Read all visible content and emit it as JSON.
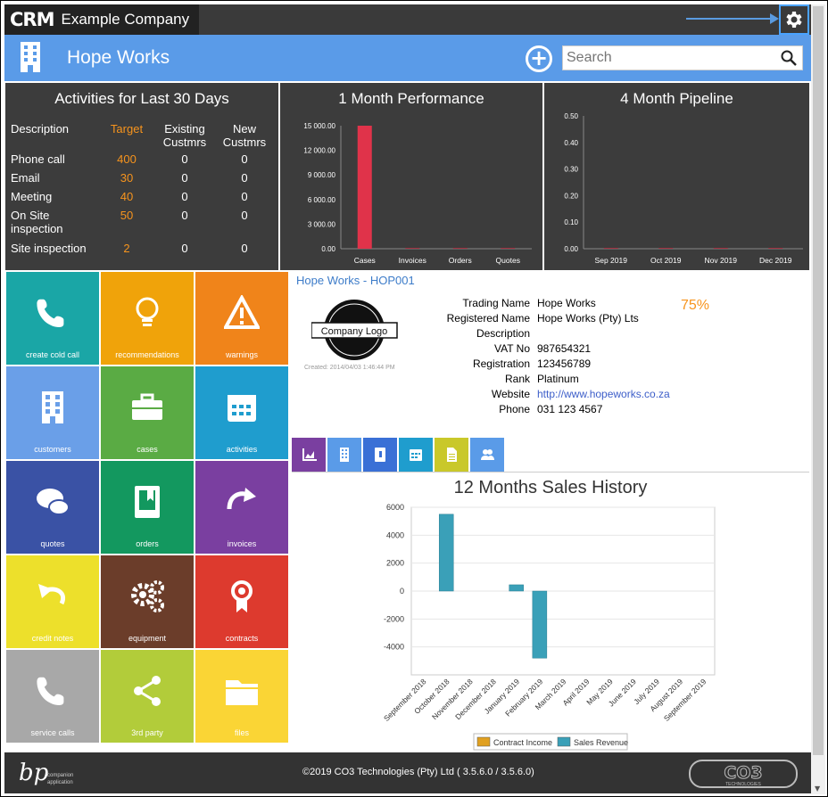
{
  "app": {
    "logo_text": "CRM",
    "company": "Example Company"
  },
  "header": {
    "title": "Hope Works",
    "search_placeholder": "Search"
  },
  "activities": {
    "title": "Activities for Last 30 Days",
    "headers": {
      "description": "Description",
      "target": "Target",
      "existing": "Existing Custmrs",
      "new": "New Custmrs"
    },
    "rows": [
      {
        "desc": "Phone call",
        "target": "400",
        "existing": "0",
        "new": "0"
      },
      {
        "desc": "Email",
        "target": "30",
        "existing": "0",
        "new": "0"
      },
      {
        "desc": "Meeting",
        "target": "40",
        "existing": "0",
        "new": "0"
      },
      {
        "desc": "On Site inspection",
        "target": "50",
        "existing": "0",
        "new": "0"
      },
      {
        "desc": "Site inspection",
        "target": "2",
        "existing": "0",
        "new": "0"
      }
    ]
  },
  "tiles": [
    {
      "label": "create cold call",
      "color": "#1aa6a6",
      "icon": "phone-icon"
    },
    {
      "label": "recommendations",
      "color": "#f0a30a",
      "icon": "lightbulb-icon"
    },
    {
      "label": "warnings",
      "color": "#f0841a",
      "icon": "warning-icon"
    },
    {
      "label": "customers",
      "color": "#6a9fe8",
      "icon": "building-icon"
    },
    {
      "label": "cases",
      "color": "#5aab44",
      "icon": "briefcase-icon"
    },
    {
      "label": "activities",
      "color": "#1f9dce",
      "icon": "calendar-icon"
    },
    {
      "label": "quotes",
      "color": "#3a52a5",
      "icon": "chat-icon"
    },
    {
      "label": "orders",
      "color": "#13985f",
      "icon": "book-icon"
    },
    {
      "label": "invoices",
      "color": "#7a3fa0",
      "icon": "redo-arrow-icon"
    },
    {
      "label": "credit notes",
      "color": "#ede02b",
      "icon": "undo-arrow-icon"
    },
    {
      "label": "equipment",
      "color": "#6b3d2a",
      "icon": "gears-icon"
    },
    {
      "label": "contracts",
      "color": "#dd3a2e",
      "icon": "award-icon"
    },
    {
      "label": "service calls",
      "color": "#a8a8a8",
      "icon": "phone-icon"
    },
    {
      "label": "3rd party",
      "color": "#b2cc3a",
      "icon": "share-icon"
    },
    {
      "label": "files",
      "color": "#fad535",
      "icon": "folder-icon"
    }
  ],
  "company": {
    "heading": "Hope Works - HOP001",
    "logo_text": "Company Logo",
    "created": "Created: 2014/04/03 1:46:44 PM",
    "percent": "75%",
    "fields": [
      {
        "key": "Trading Name",
        "value": "Hope Works"
      },
      {
        "key": "Registered Name",
        "value": "Hope Works (Pty) Lts"
      },
      {
        "key": "Description",
        "value": ""
      },
      {
        "key": "VAT No",
        "value": "987654321"
      },
      {
        "key": "Registration",
        "value": "123456789"
      },
      {
        "key": "Rank",
        "value": "Platinum"
      },
      {
        "key": "Website",
        "value": "http://www.hopeworks.co.za"
      },
      {
        "key": "Phone",
        "value": "031 123 4567"
      }
    ]
  },
  "tab_buttons": [
    {
      "icon": "area-chart-icon",
      "color": "#7a3fa0"
    },
    {
      "icon": "building-icon",
      "color": "#5a9be8"
    },
    {
      "icon": "address-book-icon",
      "color": "#3a70d6"
    },
    {
      "icon": "calendar-icon",
      "color": "#1f9dce"
    },
    {
      "icon": "document-icon",
      "color": "#c9c82a"
    },
    {
      "icon": "users-icon",
      "color": "#5a9be8"
    }
  ],
  "footer": {
    "copyright": "©2019 CO3 Technologies (Pty) Ltd ( 3.5.6.0 / 3.5.6.0)",
    "bp_text": "companion application",
    "co3_text": "CO3",
    "co3_sub": "TECHNOLOGIES"
  },
  "chart_data": [
    {
      "type": "bar",
      "title": "1 Month Performance",
      "categories": [
        "Cases",
        "Invoices",
        "Orders",
        "Quotes"
      ],
      "values": [
        15000,
        0,
        0,
        0
      ],
      "ylim": [
        0,
        15000
      ],
      "yticks": [
        "0.00",
        "3 000.00",
        "6 000.00",
        "9 000.00",
        "12 000.00",
        "15 000.00"
      ],
      "bar_color": "#e0334a"
    },
    {
      "type": "bar",
      "title": "4 Month Pipeline",
      "categories": [
        "Sep 2019",
        "Oct 2019",
        "Nov 2019",
        "Dec 2019"
      ],
      "values": [
        0,
        0,
        0,
        0
      ],
      "ylim": [
        0,
        0.5
      ],
      "yticks": [
        "0.00",
        "0.10",
        "0.20",
        "0.30",
        "0.40",
        "0.50"
      ]
    },
    {
      "type": "bar",
      "title": "12 Months Sales History",
      "categories": [
        "September 2018",
        "October 2018",
        "November 2018",
        "December 2018",
        "January 2019",
        "February 2019",
        "March 2019",
        "April 2019",
        "May 2019",
        "June 2019",
        "July 2019",
        "August 2019",
        "September 2019"
      ],
      "series": [
        {
          "name": "Contract Income",
          "color": "#e0a020",
          "values": [
            0,
            0,
            0,
            0,
            0,
            0,
            0,
            0,
            0,
            0,
            0,
            0,
            0
          ]
        },
        {
          "name": "Sales Revenue",
          "color": "#3aa0b8",
          "values": [
            0,
            5500,
            0,
            0,
            450,
            -4800,
            0,
            0,
            0,
            0,
            0,
            0,
            0
          ]
        }
      ],
      "ylim": [
        -6000,
        6000
      ],
      "yticks": [
        -4000,
        -2000,
        0,
        2000,
        4000,
        6000
      ]
    }
  ]
}
